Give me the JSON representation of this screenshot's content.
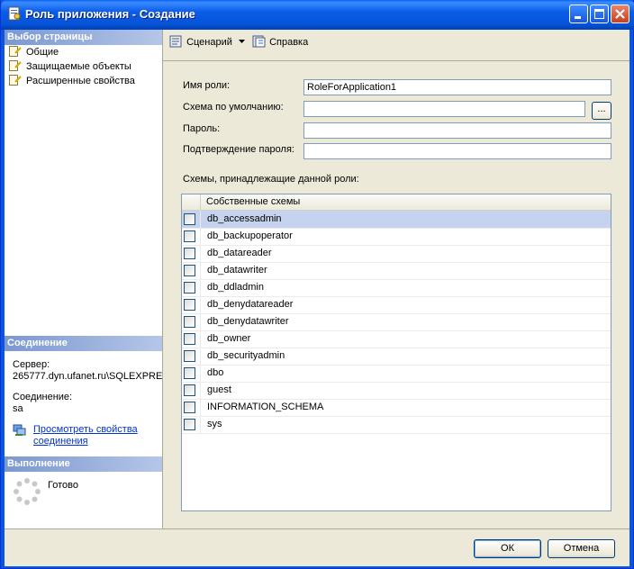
{
  "window": {
    "title": "Роль приложения - Создание"
  },
  "left_panel": {
    "select_page_header": "Выбор страницы",
    "nav_items": [
      {
        "label": "Общие",
        "icon": "page-icon"
      },
      {
        "label": "Защищаемые объекты",
        "icon": "page-icon"
      },
      {
        "label": "Расширенные свойства",
        "icon": "page-icon"
      }
    ],
    "connection_header": "Соединение",
    "server_label": "Сервер:",
    "server_value": "265777.dyn.ufanet.ru\\SQLEXPRE",
    "connection_label": "Соединение:",
    "connection_value": "sa",
    "view_props_link_line1": "Просмотреть свойства",
    "view_props_link_line2": "соединения",
    "progress_header": "Выполнение",
    "status_text": "Готово"
  },
  "toolbar": {
    "script_label": "Сценарий",
    "help_label": "Справка"
  },
  "form": {
    "role_name_label": "Имя роли:",
    "role_name_value": "RoleForApplication1",
    "default_schema_label": "Схема по умолчанию:",
    "default_schema_value": "",
    "browse_label": "...",
    "password_label": "Пароль:",
    "password_value": "",
    "confirm_password_label": "Подтверждение пароля:",
    "confirm_password_value": "",
    "schemas_owned_label": "Схемы, принадлежащие данной роли:"
  },
  "schemas_grid": {
    "column_header": "Собственные схемы",
    "rows": [
      "db_accessadmin",
      "db_backupoperator",
      "db_datareader",
      "db_datawriter",
      "db_ddladmin",
      "db_denydatareader",
      "db_denydatawriter",
      "db_owner",
      "db_securityadmin",
      "dbo",
      "guest",
      "INFORMATION_SCHEMA",
      "sys"
    ],
    "selected_row": 0
  },
  "buttons": {
    "ok_label": "ОК",
    "cancel_label": "Отмена"
  },
  "colors": {
    "title_bar": "#0a5ce8",
    "section_header": "#7b98cf",
    "selected_row": "#c5d3ef",
    "link": "#0033cc"
  }
}
